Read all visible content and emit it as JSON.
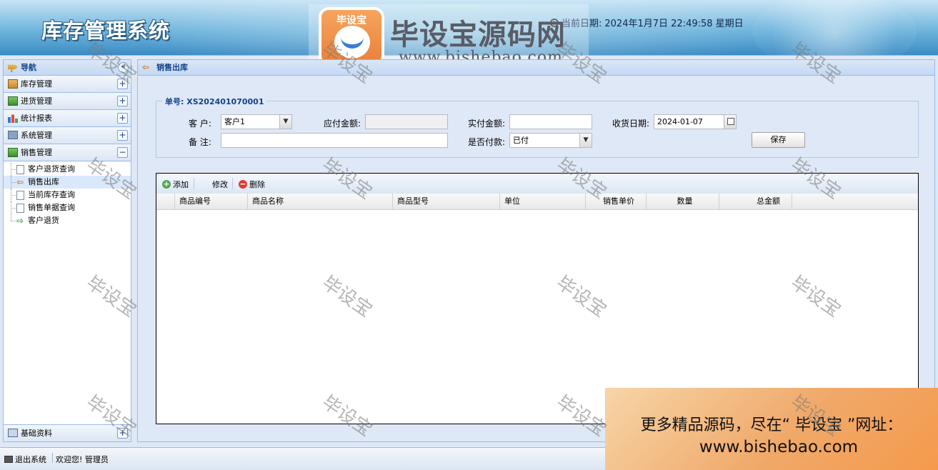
{
  "header": {
    "title": "库存管理系统",
    "datetime_label": "当前日期:",
    "datetime_value": "2024年1月7日 22:49:58 星期日"
  },
  "brand": {
    "logo_text": "毕设宝",
    "name": "毕设宝源码网",
    "url": "www.bishebao.com"
  },
  "nav": {
    "title": "导航",
    "sections": [
      {
        "label": "库存管理",
        "icon": "box-icon"
      },
      {
        "label": "进货管理",
        "icon": "inbound-icon"
      },
      {
        "label": "统计报表",
        "icon": "chart-icon"
      },
      {
        "label": "系统管理",
        "icon": "system-icon"
      },
      {
        "label": "销售管理",
        "icon": "sales-icon"
      }
    ],
    "sales_items": [
      {
        "label": "客户退货查询"
      },
      {
        "label": "销售出库"
      },
      {
        "label": "当前库存查询"
      },
      {
        "label": "销售单据查询"
      },
      {
        "label": "客户退货"
      }
    ],
    "bottom_section": {
      "label": "基础资料"
    }
  },
  "main": {
    "title": "销售出库",
    "order_label": "单号: XS202401070001",
    "form": {
      "customer_label": "客  户:",
      "customer_value": "客户1",
      "payable_label": "应付金额:",
      "payable_value": "",
      "paid_label": "实付金额:",
      "paid_value": "",
      "date_label": "收货日期:",
      "date_value": "2024-01-07",
      "remark_label": "备  注:",
      "remark_value": "",
      "is_paid_label": "是否付款:",
      "is_paid_value": "已付",
      "save_label": "保存"
    },
    "toolbar": {
      "add_label": "添加",
      "edit_label": "修改",
      "delete_label": "删除"
    },
    "columns": [
      "商品编号",
      "商品名称",
      "商品型号",
      "单位",
      "销售单价",
      "数量",
      "总金额"
    ]
  },
  "statusbar": {
    "logout_label": "退出系统",
    "welcome_label": "欢迎您! 管理员"
  },
  "promo": {
    "line1": "更多精品源码，尽在“ 毕设宝 ”网址：",
    "line2": "www.bishebao.com"
  },
  "watermark": {
    "text": "毕设宝"
  }
}
